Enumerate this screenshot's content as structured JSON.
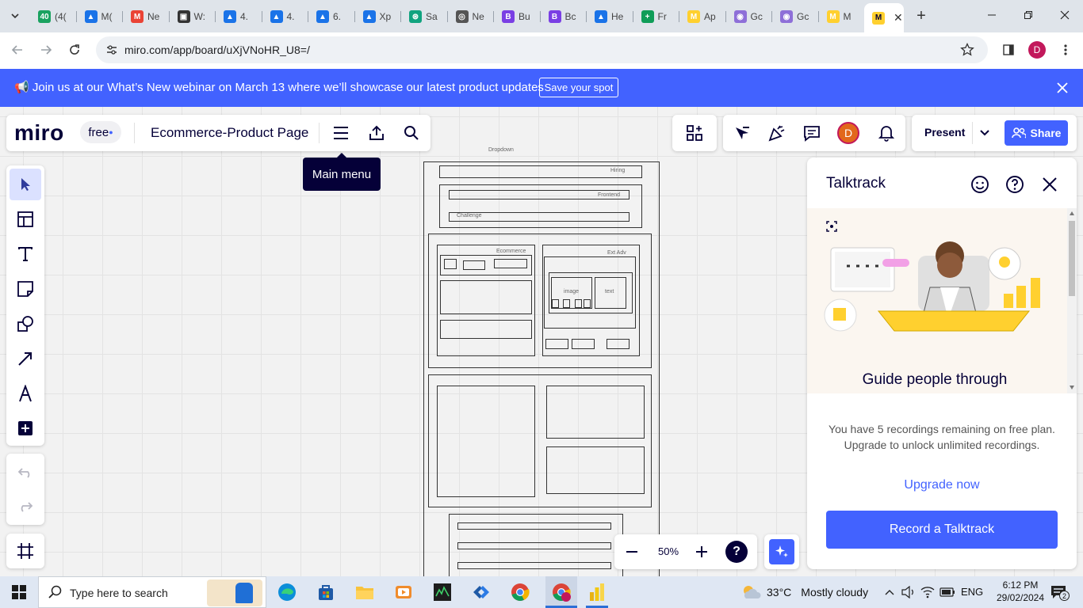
{
  "browser": {
    "tabs": [
      {
        "label": "(4(",
        "color": "#1aa260",
        "glyph": "40"
      },
      {
        "label": "M(",
        "color": "#1a73e8",
        "glyph": "▲"
      },
      {
        "label": "Ne",
        "color": "#ea4335",
        "glyph": "M"
      },
      {
        "label": "W:",
        "color": "#333333",
        "glyph": "▣"
      },
      {
        "label": "4.",
        "color": "#1a73e8",
        "glyph": "▲"
      },
      {
        "label": "4.",
        "color": "#1a73e8",
        "glyph": "▲"
      },
      {
        "label": "6.",
        "color": "#1a73e8",
        "glyph": "▲"
      },
      {
        "label": "Xp",
        "color": "#1a73e8",
        "glyph": "▲"
      },
      {
        "label": "Sa",
        "color": "#10a37f",
        "glyph": "⊛"
      },
      {
        "label": "Ne",
        "color": "#555555",
        "glyph": "◎"
      },
      {
        "label": "Bu",
        "color": "#7a3fe4",
        "glyph": "B"
      },
      {
        "label": "Bc",
        "color": "#7a3fe4",
        "glyph": "B"
      },
      {
        "label": "He",
        "color": "#1a73e8",
        "glyph": "▲"
      },
      {
        "label": "Fr",
        "color": "#0f9d58",
        "glyph": "+"
      },
      {
        "label": "Ap",
        "color": "#ffd02f",
        "glyph": "M"
      },
      {
        "label": "Gc",
        "color": "#8e6fd8",
        "glyph": "◉"
      },
      {
        "label": "Gc",
        "color": "#8e6fd8",
        "glyph": "◉"
      },
      {
        "label": "M",
        "color": "#ffd02f",
        "glyph": "M"
      }
    ],
    "url": "miro.com/app/board/uXjVNoHR_U8=/",
    "profile_initial": "D"
  },
  "banner": {
    "text": "Join us at our What’s New webinar on March 13 where we’ll showcase our latest product updates",
    "button": "Save your spot"
  },
  "miro": {
    "logo": "miro",
    "plan_badge": "free",
    "board_title": "Ecommerce-Product Page",
    "tooltip": "Main menu",
    "present_label": "Present",
    "share_label": "Share",
    "avatar_initial": "D",
    "zoom": "50%",
    "help_glyph": "?"
  },
  "wireframe": {
    "dropdown": "Dropdown",
    "hiring": "Hiring",
    "frontend": "Frontend",
    "challenge": "Challenge",
    "ecommerce": "Ecommerce",
    "ext_adv": "Ext Adv",
    "image": "image",
    "text": "text"
  },
  "talktrack": {
    "title": "Talktrack",
    "guide_heading": "Guide people through",
    "info": "You have 5 recordings remaining on free plan. Upgrade to unlock unlimited recordings.",
    "upgrade_link": "Upgrade now",
    "record_button": "Record a Talktrack"
  },
  "taskbar": {
    "search_placeholder": "Type here to search",
    "temperature": "33°C",
    "weather": "Mostly cloudy",
    "language": "ENG",
    "time": "6:12 PM",
    "date": "29/02/2024",
    "notifications": "2"
  },
  "colors": {
    "accent": "#4262ff",
    "tab_bg": "#dfe4ea",
    "canvas_bg": "#f2f2f2",
    "avatar": "#e2681c"
  }
}
